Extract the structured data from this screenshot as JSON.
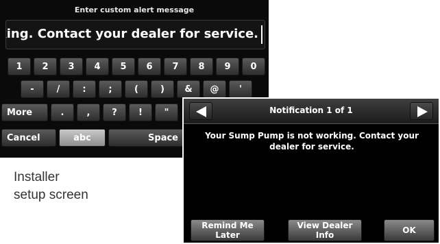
{
  "keyboard_screen": {
    "title": "Enter custom alert message",
    "input_value": "orking. Contact your dealer for service.",
    "row1": [
      "1",
      "2",
      "3",
      "4",
      "5",
      "6",
      "7",
      "8",
      "9",
      "0"
    ],
    "row2": [
      "-",
      "/",
      ":",
      ";",
      "(",
      ")",
      "&",
      "@",
      "'"
    ],
    "row3": [
      "More",
      ".",
      ",",
      "?",
      "!",
      "\""
    ],
    "row4": {
      "cancel": "Cancel",
      "abc": "abc",
      "space": "Space"
    }
  },
  "notification_screen": {
    "title": "Notification 1 of 1",
    "message": "Your Sump Pump is not working. Contact your dealer for service.",
    "buttons": {
      "remind_line1": "Remind Me",
      "remind_line2": "Later",
      "dealer_line1": "View Dealer",
      "dealer_line2": "Info",
      "ok": "OK"
    },
    "icons": {
      "prev": "left-arrow-icon",
      "next": "right-arrow-icon"
    }
  },
  "caption": {
    "line1": "Installer",
    "line2": "setup screen"
  },
  "colors": {
    "screen_bg": "#000000",
    "key": "#4a4a4a",
    "active_key": "#b0b0b0",
    "text": "#ffffff"
  }
}
